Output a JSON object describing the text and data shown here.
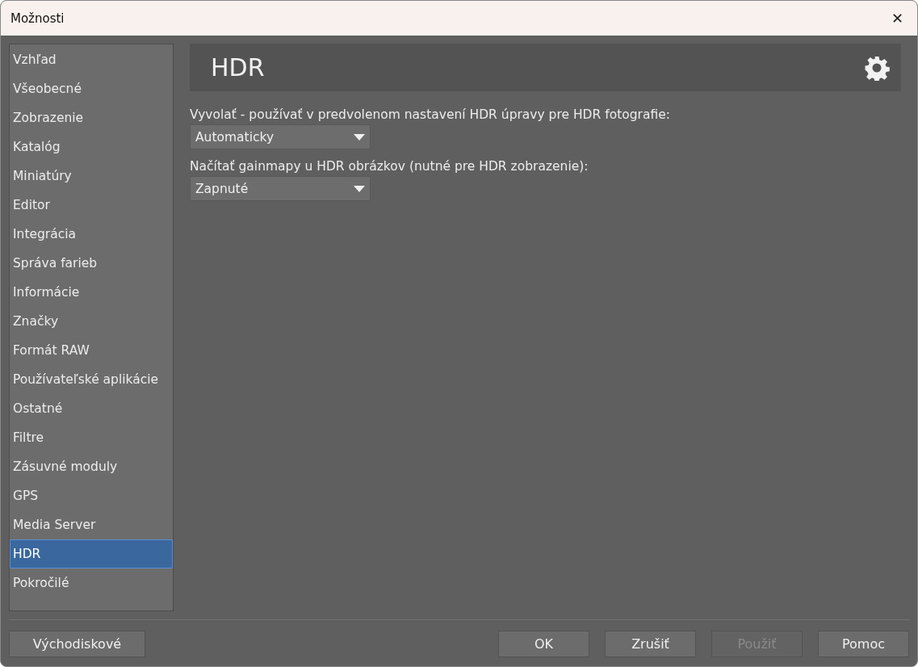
{
  "window": {
    "title": "Možnosti",
    "close": "✕"
  },
  "sidebar": {
    "items": [
      {
        "label": "Vzhľad",
        "selected": false
      },
      {
        "label": "Všeobecné",
        "selected": false
      },
      {
        "label": "Zobrazenie",
        "selected": false
      },
      {
        "label": "Katalóg",
        "selected": false
      },
      {
        "label": "Miniatúry",
        "selected": false
      },
      {
        "label": "Editor",
        "selected": false
      },
      {
        "label": "Integrácia",
        "selected": false
      },
      {
        "label": "Správa farieb",
        "selected": false
      },
      {
        "label": "Informácie",
        "selected": false
      },
      {
        "label": "Značky",
        "selected": false
      },
      {
        "label": "Formát RAW",
        "selected": false
      },
      {
        "label": "Používateľské aplikácie",
        "selected": false
      },
      {
        "label": "Ostatné",
        "selected": false
      },
      {
        "label": "Filtre",
        "selected": false
      },
      {
        "label": "Zásuvné moduly",
        "selected": false
      },
      {
        "label": "GPS",
        "selected": false
      },
      {
        "label": "Media Server",
        "selected": false
      },
      {
        "label": "HDR",
        "selected": true
      },
      {
        "label": "Pokročilé",
        "selected": false
      }
    ]
  },
  "panel": {
    "title": "HDR",
    "settings": [
      {
        "label": "Vyvolať - používať v predvolenom nastavení HDR úpravy pre HDR fotografie:",
        "value": "Automaticky"
      },
      {
        "label": "Načítať gainmapy u HDR obrázkov (nutné pre HDR zobrazenie):",
        "value": "Zapnuté"
      }
    ]
  },
  "footer": {
    "left_buttons": [
      {
        "label": "Východiskové",
        "disabled": false
      }
    ],
    "right_buttons": [
      {
        "label": "OK",
        "disabled": false
      },
      {
        "label": "Zrušiť",
        "disabled": false
      },
      {
        "label": "Použiť",
        "disabled": true
      },
      {
        "label": "Pomoc",
        "disabled": false
      }
    ]
  }
}
